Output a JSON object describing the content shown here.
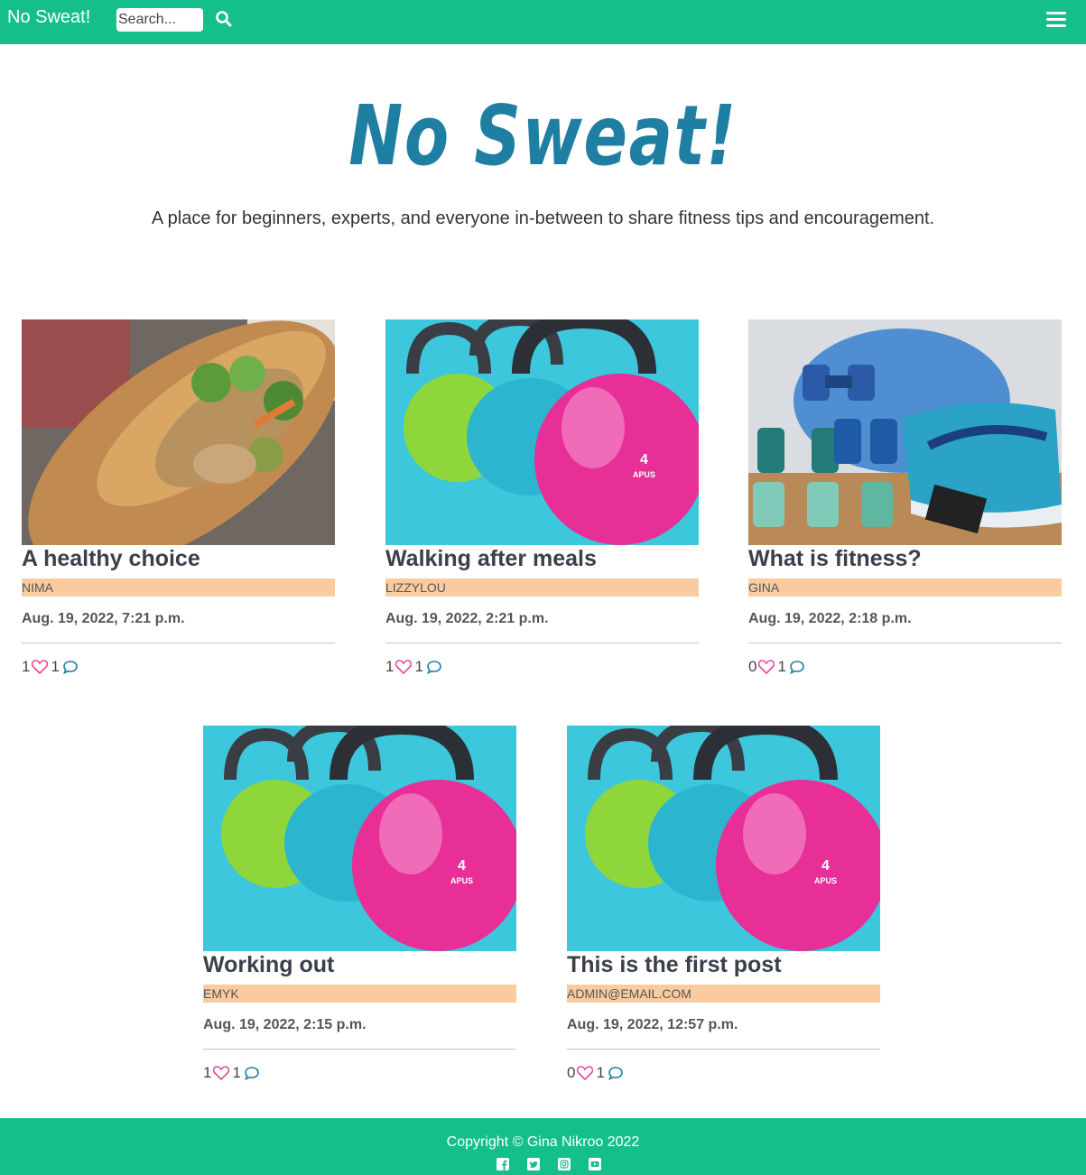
{
  "nav": {
    "brand": "No Sweat!",
    "search_placeholder": "Search...",
    "search_icon": "search-icon",
    "menu_icon": "hamburger-menu-icon"
  },
  "hero": {
    "title": "No Sweat!",
    "tagline": "A place for beginners, experts, and everyone in-between to share fitness tips and encouragement."
  },
  "posts": [
    {
      "title": "A healthy choice",
      "author": "NIMA",
      "date": "Aug. 19, 2022, 7:21 p.m.",
      "likes": "1",
      "comments": "1",
      "image": "sandwich"
    },
    {
      "title": "Walking after meals",
      "author": "LIZZYLOU",
      "date": "Aug. 19, 2022, 2:21 p.m.",
      "likes": "1",
      "comments": "1",
      "image": "kettlebells"
    },
    {
      "title": "What is fitness?",
      "author": "GINA",
      "date": "Aug. 19, 2022, 2:18 p.m.",
      "likes": "0",
      "comments": "1",
      "image": "dumbbells-shoe"
    },
    {
      "title": "Working out",
      "author": "EMYK",
      "date": "Aug. 19, 2022, 2:15 p.m.",
      "likes": "1",
      "comments": "1",
      "image": "kettlebells"
    },
    {
      "title": "This is the first post",
      "author": "ADMIN@EMAIL.COM",
      "date": "Aug. 19, 2022, 12:57 p.m.",
      "likes": "0",
      "comments": "1",
      "image": "kettlebells"
    }
  ],
  "footer": {
    "copyright": "Copyright © Gina Nikroo 2022",
    "social_icons": [
      "facebook-icon",
      "twitter-icon",
      "instagram-icon",
      "youtube-icon"
    ]
  },
  "colors": {
    "brand": "#14bf8c",
    "title": "#1f7fa3",
    "author_badge": "#fbcba0",
    "heart": "#e8479b",
    "comment": "#1f7fa3"
  }
}
